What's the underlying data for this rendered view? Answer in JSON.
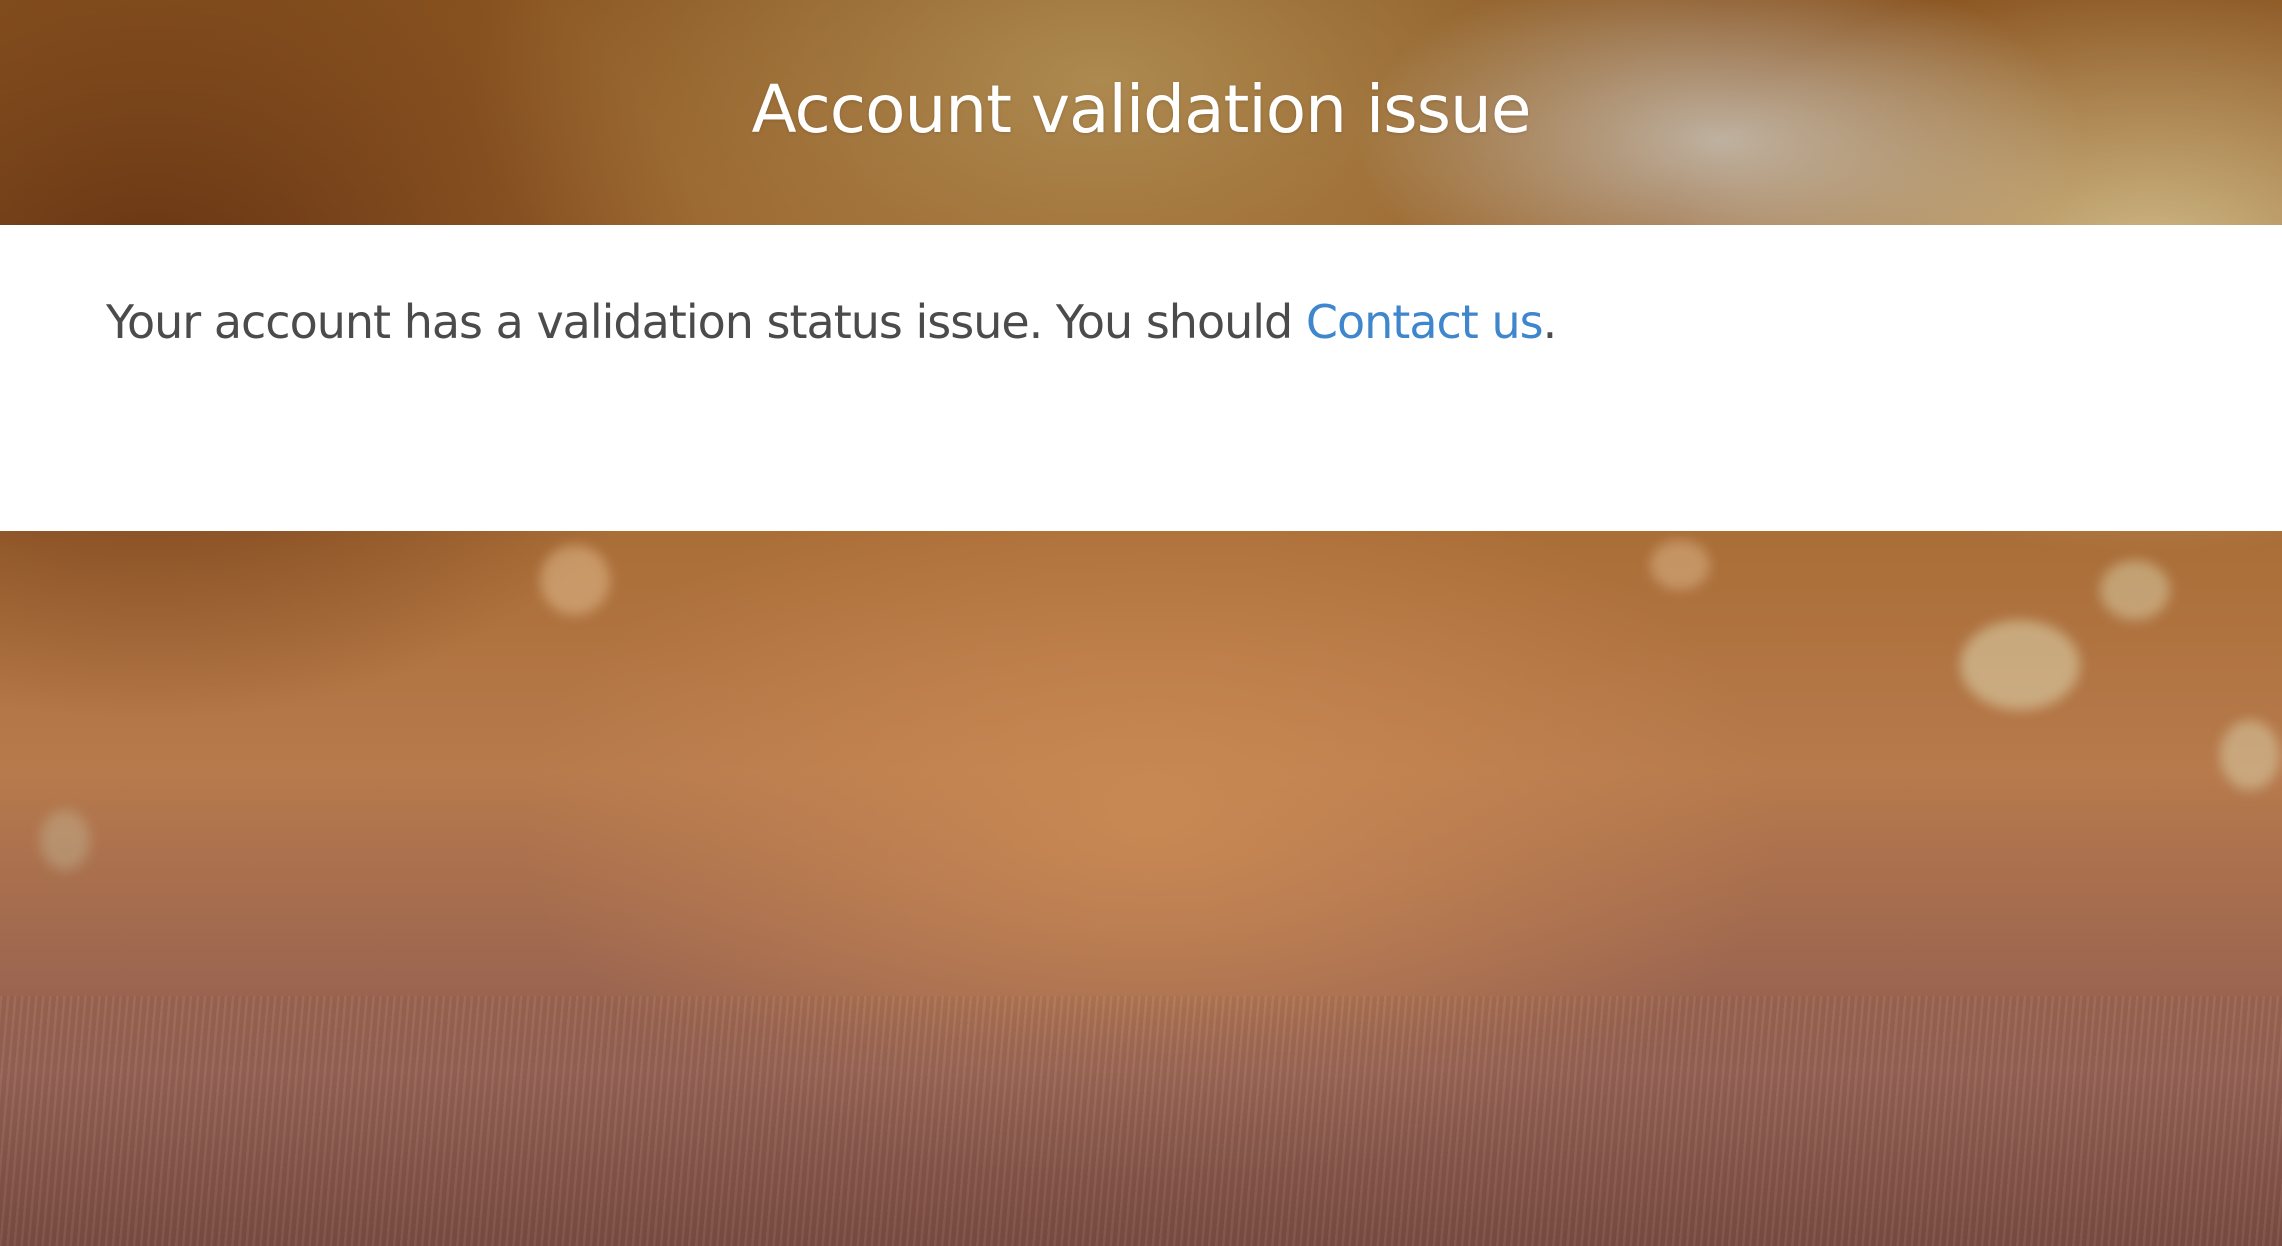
{
  "header": {
    "title": "Account validation issue"
  },
  "panel": {
    "message_text": "Your account has a validation status issue. You should ",
    "link_label": "Contact us",
    "message_suffix": "."
  },
  "colors": {
    "link": "#3f86cc",
    "body_text": "#4b4b4b",
    "panel_background": "#ffffff",
    "title": "#ffffff"
  }
}
